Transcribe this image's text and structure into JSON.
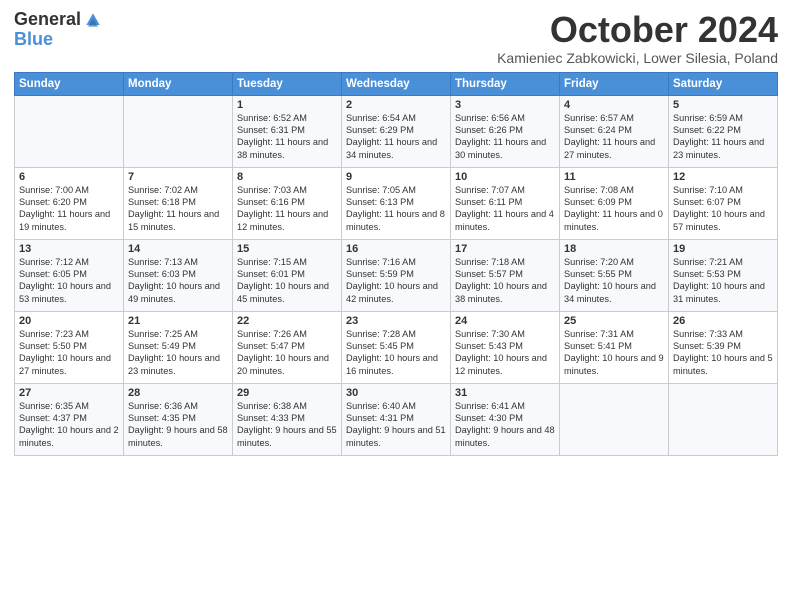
{
  "header": {
    "logo_general": "General",
    "logo_blue": "Blue",
    "month_title": "October 2024",
    "subtitle": "Kamieniec Zabkowicki, Lower Silesia, Poland"
  },
  "weekdays": [
    "Sunday",
    "Monday",
    "Tuesday",
    "Wednesday",
    "Thursday",
    "Friday",
    "Saturday"
  ],
  "weeks": [
    [
      {
        "day": "",
        "sunrise": "",
        "sunset": "",
        "daylight": ""
      },
      {
        "day": "",
        "sunrise": "",
        "sunset": "",
        "daylight": ""
      },
      {
        "day": "1",
        "sunrise": "Sunrise: 6:52 AM",
        "sunset": "Sunset: 6:31 PM",
        "daylight": "Daylight: 11 hours and 38 minutes."
      },
      {
        "day": "2",
        "sunrise": "Sunrise: 6:54 AM",
        "sunset": "Sunset: 6:29 PM",
        "daylight": "Daylight: 11 hours and 34 minutes."
      },
      {
        "day": "3",
        "sunrise": "Sunrise: 6:56 AM",
        "sunset": "Sunset: 6:26 PM",
        "daylight": "Daylight: 11 hours and 30 minutes."
      },
      {
        "day": "4",
        "sunrise": "Sunrise: 6:57 AM",
        "sunset": "Sunset: 6:24 PM",
        "daylight": "Daylight: 11 hours and 27 minutes."
      },
      {
        "day": "5",
        "sunrise": "Sunrise: 6:59 AM",
        "sunset": "Sunset: 6:22 PM",
        "daylight": "Daylight: 11 hours and 23 minutes."
      }
    ],
    [
      {
        "day": "6",
        "sunrise": "Sunrise: 7:00 AM",
        "sunset": "Sunset: 6:20 PM",
        "daylight": "Daylight: 11 hours and 19 minutes."
      },
      {
        "day": "7",
        "sunrise": "Sunrise: 7:02 AM",
        "sunset": "Sunset: 6:18 PM",
        "daylight": "Daylight: 11 hours and 15 minutes."
      },
      {
        "day": "8",
        "sunrise": "Sunrise: 7:03 AM",
        "sunset": "Sunset: 6:16 PM",
        "daylight": "Daylight: 11 hours and 12 minutes."
      },
      {
        "day": "9",
        "sunrise": "Sunrise: 7:05 AM",
        "sunset": "Sunset: 6:13 PM",
        "daylight": "Daylight: 11 hours and 8 minutes."
      },
      {
        "day": "10",
        "sunrise": "Sunrise: 7:07 AM",
        "sunset": "Sunset: 6:11 PM",
        "daylight": "Daylight: 11 hours and 4 minutes."
      },
      {
        "day": "11",
        "sunrise": "Sunrise: 7:08 AM",
        "sunset": "Sunset: 6:09 PM",
        "daylight": "Daylight: 11 hours and 0 minutes."
      },
      {
        "day": "12",
        "sunrise": "Sunrise: 7:10 AM",
        "sunset": "Sunset: 6:07 PM",
        "daylight": "Daylight: 10 hours and 57 minutes."
      }
    ],
    [
      {
        "day": "13",
        "sunrise": "Sunrise: 7:12 AM",
        "sunset": "Sunset: 6:05 PM",
        "daylight": "Daylight: 10 hours and 53 minutes."
      },
      {
        "day": "14",
        "sunrise": "Sunrise: 7:13 AM",
        "sunset": "Sunset: 6:03 PM",
        "daylight": "Daylight: 10 hours and 49 minutes."
      },
      {
        "day": "15",
        "sunrise": "Sunrise: 7:15 AM",
        "sunset": "Sunset: 6:01 PM",
        "daylight": "Daylight: 10 hours and 45 minutes."
      },
      {
        "day": "16",
        "sunrise": "Sunrise: 7:16 AM",
        "sunset": "Sunset: 5:59 PM",
        "daylight": "Daylight: 10 hours and 42 minutes."
      },
      {
        "day": "17",
        "sunrise": "Sunrise: 7:18 AM",
        "sunset": "Sunset: 5:57 PM",
        "daylight": "Daylight: 10 hours and 38 minutes."
      },
      {
        "day": "18",
        "sunrise": "Sunrise: 7:20 AM",
        "sunset": "Sunset: 5:55 PM",
        "daylight": "Daylight: 10 hours and 34 minutes."
      },
      {
        "day": "19",
        "sunrise": "Sunrise: 7:21 AM",
        "sunset": "Sunset: 5:53 PM",
        "daylight": "Daylight: 10 hours and 31 minutes."
      }
    ],
    [
      {
        "day": "20",
        "sunrise": "Sunrise: 7:23 AM",
        "sunset": "Sunset: 5:50 PM",
        "daylight": "Daylight: 10 hours and 27 minutes."
      },
      {
        "day": "21",
        "sunrise": "Sunrise: 7:25 AM",
        "sunset": "Sunset: 5:49 PM",
        "daylight": "Daylight: 10 hours and 23 minutes."
      },
      {
        "day": "22",
        "sunrise": "Sunrise: 7:26 AM",
        "sunset": "Sunset: 5:47 PM",
        "daylight": "Daylight: 10 hours and 20 minutes."
      },
      {
        "day": "23",
        "sunrise": "Sunrise: 7:28 AM",
        "sunset": "Sunset: 5:45 PM",
        "daylight": "Daylight: 10 hours and 16 minutes."
      },
      {
        "day": "24",
        "sunrise": "Sunrise: 7:30 AM",
        "sunset": "Sunset: 5:43 PM",
        "daylight": "Daylight: 10 hours and 12 minutes."
      },
      {
        "day": "25",
        "sunrise": "Sunrise: 7:31 AM",
        "sunset": "Sunset: 5:41 PM",
        "daylight": "Daylight: 10 hours and 9 minutes."
      },
      {
        "day": "26",
        "sunrise": "Sunrise: 7:33 AM",
        "sunset": "Sunset: 5:39 PM",
        "daylight": "Daylight: 10 hours and 5 minutes."
      }
    ],
    [
      {
        "day": "27",
        "sunrise": "Sunrise: 6:35 AM",
        "sunset": "Sunset: 4:37 PM",
        "daylight": "Daylight: 10 hours and 2 minutes."
      },
      {
        "day": "28",
        "sunrise": "Sunrise: 6:36 AM",
        "sunset": "Sunset: 4:35 PM",
        "daylight": "Daylight: 9 hours and 58 minutes."
      },
      {
        "day": "29",
        "sunrise": "Sunrise: 6:38 AM",
        "sunset": "Sunset: 4:33 PM",
        "daylight": "Daylight: 9 hours and 55 minutes."
      },
      {
        "day": "30",
        "sunrise": "Sunrise: 6:40 AM",
        "sunset": "Sunset: 4:31 PM",
        "daylight": "Daylight: 9 hours and 51 minutes."
      },
      {
        "day": "31",
        "sunrise": "Sunrise: 6:41 AM",
        "sunset": "Sunset: 4:30 PM",
        "daylight": "Daylight: 9 hours and 48 minutes."
      },
      {
        "day": "",
        "sunrise": "",
        "sunset": "",
        "daylight": ""
      },
      {
        "day": "",
        "sunrise": "",
        "sunset": "",
        "daylight": ""
      }
    ]
  ]
}
